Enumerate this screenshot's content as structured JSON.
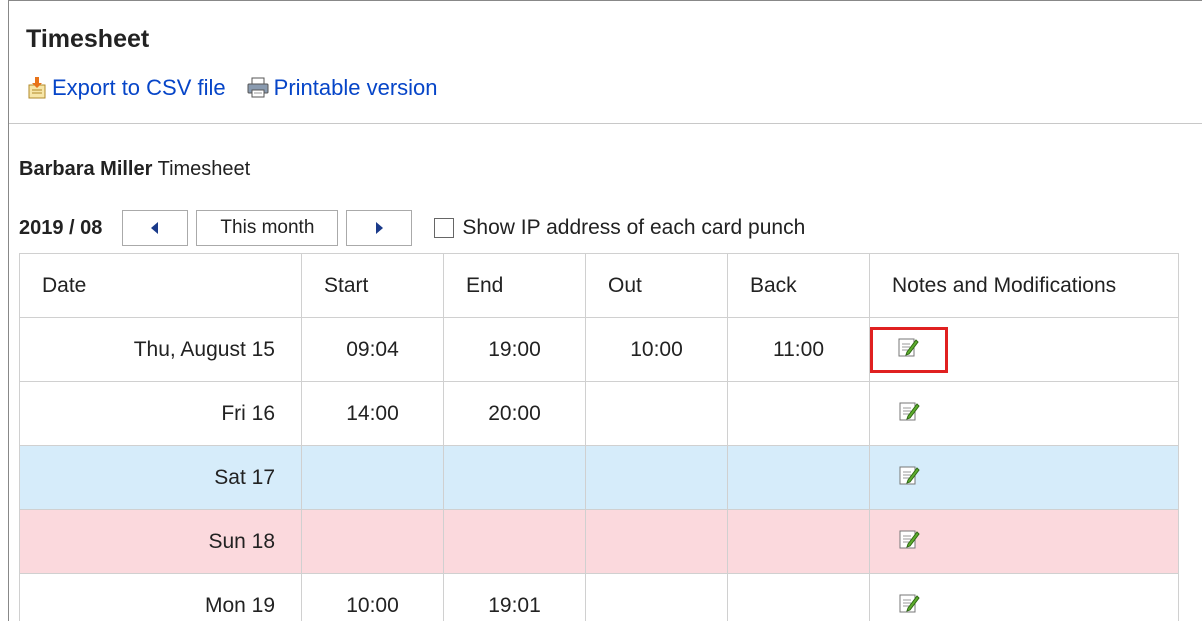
{
  "page": {
    "title": "Timesheet"
  },
  "actions": {
    "export_label": "Export to CSV file",
    "print_label": "Printable version"
  },
  "user": {
    "name": "Barbara Miller",
    "suffix": "Timesheet"
  },
  "nav": {
    "month": "2019 / 08",
    "this_month_label": "This month",
    "ip_checkbox_label": "Show IP address of each card punch",
    "ip_checkbox_checked": false
  },
  "table": {
    "columns": [
      "Date",
      "Start",
      "End",
      "Out",
      "Back",
      "Notes and Modifications"
    ],
    "rows": [
      {
        "date": "Thu, August 15",
        "start": "09:04",
        "end": "19:00",
        "out": "10:00",
        "back": "11:00",
        "type": "weekday"
      },
      {
        "date": "Fri 16",
        "start": "14:00",
        "end": "20:00",
        "out": "",
        "back": "",
        "type": "weekday"
      },
      {
        "date": "Sat 17",
        "start": "",
        "end": "",
        "out": "",
        "back": "",
        "type": "saturday"
      },
      {
        "date": "Sun 18",
        "start": "",
        "end": "",
        "out": "",
        "back": "",
        "type": "sunday"
      },
      {
        "date": "Mon 19",
        "start": "10:00",
        "end": "19:01",
        "out": "",
        "back": "",
        "type": "weekday"
      }
    ]
  },
  "colors": {
    "link": "#0645c8",
    "saturday_bg": "#d6ecfa",
    "sunday_bg": "#fbd9dd",
    "highlight_border": "#e02020"
  }
}
